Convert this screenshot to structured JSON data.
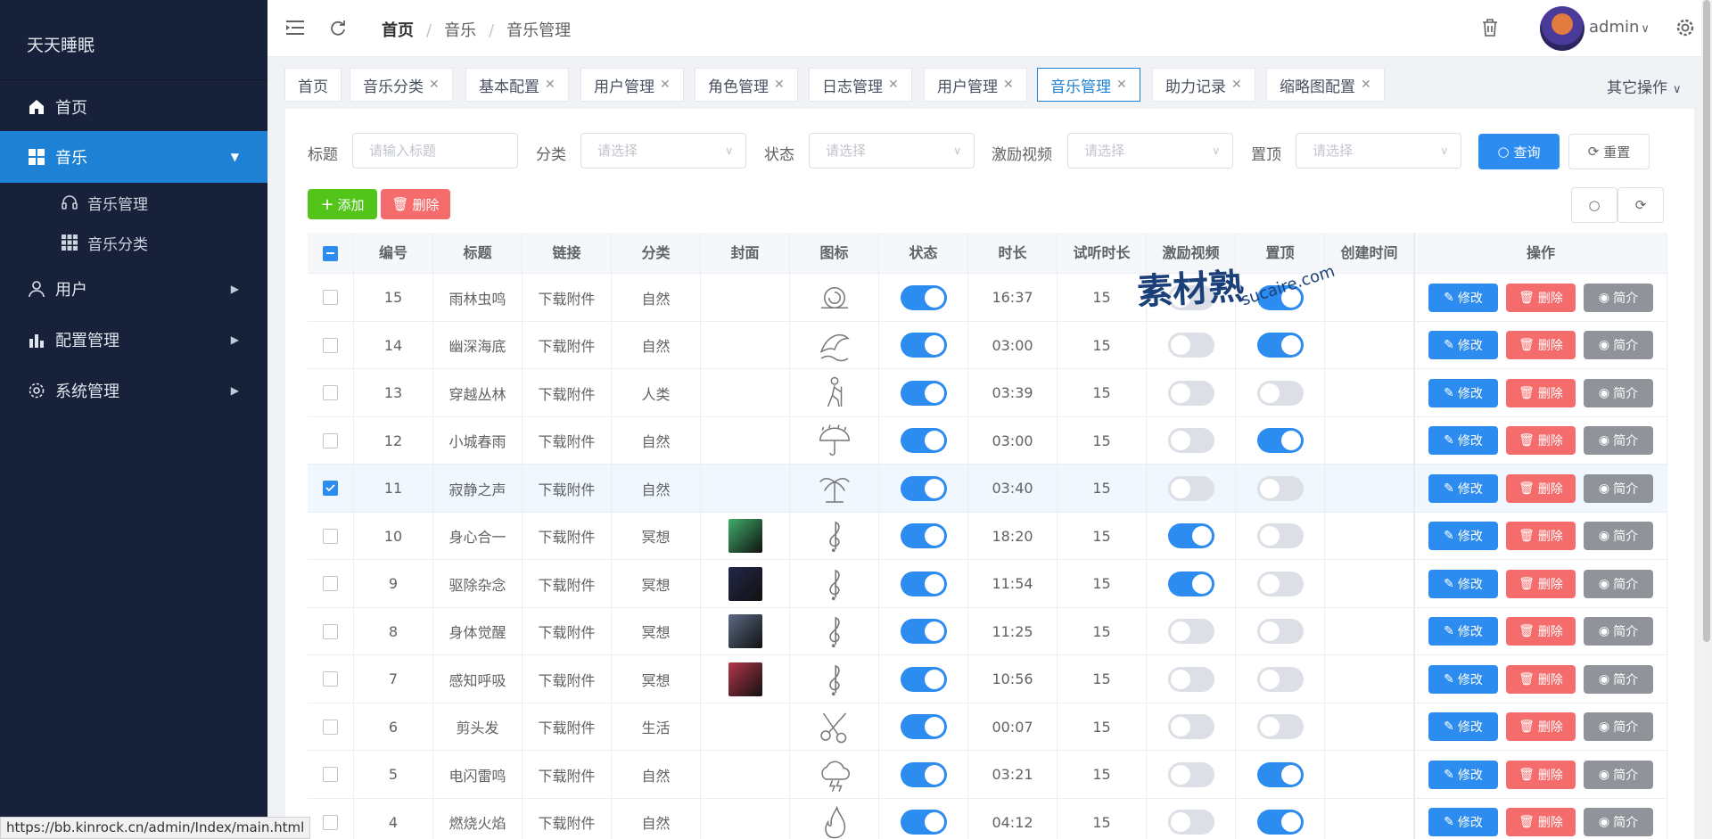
{
  "app": {
    "brand": "天天睡眠"
  },
  "sidebar": {
    "items": [
      {
        "label": "首页",
        "icon": "home-icon"
      },
      {
        "label": "音乐",
        "icon": "grid-icon"
      },
      {
        "label": "用户",
        "icon": "user-icon"
      },
      {
        "label": "配置管理",
        "icon": "bar-chart-icon"
      },
      {
        "label": "系统管理",
        "icon": "gear-icon"
      }
    ],
    "subitems": [
      {
        "label": "音乐管理",
        "icon": "headphones-icon"
      },
      {
        "label": "音乐分类",
        "icon": "grid-icon"
      }
    ]
  },
  "header": {
    "breadcrumb": [
      "首页",
      "音乐",
      "音乐管理"
    ],
    "username": "admin"
  },
  "tabs": [
    {
      "label": "首页",
      "closable": false
    },
    {
      "label": "音乐分类",
      "closable": true
    },
    {
      "label": "基本配置",
      "closable": true
    },
    {
      "label": "用户管理",
      "closable": true
    },
    {
      "label": "角色管理",
      "closable": true
    },
    {
      "label": "日志管理",
      "closable": true
    },
    {
      "label": "用户管理",
      "closable": true
    },
    {
      "label": "音乐管理",
      "closable": true,
      "active": true
    },
    {
      "label": "助力记录",
      "closable": true
    },
    {
      "label": "缩略图配置",
      "closable": true
    }
  ],
  "tabs_other": "其它操作",
  "filters": {
    "title_label": "标题",
    "title_placeholder": "请输入标题",
    "category_label": "分类",
    "status_label": "状态",
    "video_label": "激励视频",
    "top_label": "置顶",
    "select_placeholder": "请选择",
    "query_label": "查询",
    "reset_label": "重置"
  },
  "toolbar": {
    "add_label": "添加",
    "delete_label": "删除"
  },
  "table": {
    "columns": [
      "编号",
      "标题",
      "链接",
      "分类",
      "封面",
      "图标",
      "状态",
      "时长",
      "试听时长",
      "激励视频",
      "置顶",
      "创建时间",
      "操作"
    ],
    "action_labels": {
      "edit": "修改",
      "delete": "删除",
      "intro": "简介"
    },
    "rows": [
      {
        "id": "15",
        "title": "雨林虫鸣",
        "link": "下载附件",
        "category": "自然",
        "cover": null,
        "icon": "snail-icon",
        "status": true,
        "duration": "16:37",
        "trial": "15",
        "video": false,
        "top": true,
        "checked": false
      },
      {
        "id": "14",
        "title": "幽深海底",
        "link": "下载附件",
        "category": "自然",
        "cover": null,
        "icon": "dolphin-icon",
        "status": true,
        "duration": "03:00",
        "trial": "15",
        "video": false,
        "top": true,
        "checked": false
      },
      {
        "id": "13",
        "title": "穿越丛林",
        "link": "下载附件",
        "category": "人类",
        "cover": null,
        "icon": "hiker-icon",
        "status": true,
        "duration": "03:39",
        "trial": "15",
        "video": false,
        "top": false,
        "checked": false
      },
      {
        "id": "12",
        "title": "小城春雨",
        "link": "下载附件",
        "category": "自然",
        "cover": null,
        "icon": "umbrella-icon",
        "status": true,
        "duration": "03:00",
        "trial": "15",
        "video": false,
        "top": true,
        "checked": false
      },
      {
        "id": "11",
        "title": "寂静之声",
        "link": "下载附件",
        "category": "自然",
        "cover": null,
        "icon": "palm-tree-icon",
        "status": true,
        "duration": "03:40",
        "trial": "15",
        "video": false,
        "top": false,
        "checked": true
      },
      {
        "id": "10",
        "title": "身心合一",
        "link": "下载附件",
        "category": "冥想",
        "cover": "#3fae6a",
        "icon": "treble-clef-icon",
        "status": true,
        "duration": "18:20",
        "trial": "15",
        "video": true,
        "top": false,
        "checked": false
      },
      {
        "id": "9",
        "title": "驱除杂念",
        "link": "下载附件",
        "category": "冥想",
        "cover": "#23274a",
        "icon": "treble-clef-icon",
        "status": true,
        "duration": "11:54",
        "trial": "15",
        "video": true,
        "top": false,
        "checked": false
      },
      {
        "id": "8",
        "title": "身体觉醒",
        "link": "下载附件",
        "category": "冥想",
        "cover": "#5b6a85",
        "icon": "treble-clef-icon",
        "status": true,
        "duration": "11:25",
        "trial": "15",
        "video": false,
        "top": false,
        "checked": false
      },
      {
        "id": "7",
        "title": "感知呼吸",
        "link": "下载附件",
        "category": "冥想",
        "cover": "#b3364a",
        "icon": "treble-clef-icon",
        "status": true,
        "duration": "10:56",
        "trial": "15",
        "video": false,
        "top": false,
        "checked": false
      },
      {
        "id": "6",
        "title": "剪头发",
        "link": "下载附件",
        "category": "生活",
        "cover": null,
        "icon": "scissors-icon",
        "status": true,
        "duration": "00:07",
        "trial": "15",
        "video": false,
        "top": false,
        "checked": false
      },
      {
        "id": "5",
        "title": "电闪雷鸣",
        "link": "下载附件",
        "category": "自然",
        "cover": null,
        "icon": "thunder-cloud-icon",
        "status": true,
        "duration": "03:21",
        "trial": "15",
        "video": false,
        "top": true,
        "checked": false
      },
      {
        "id": "4",
        "title": "燃烧火焰",
        "link": "下载附件",
        "category": "自然",
        "cover": null,
        "icon": "flame-icon",
        "status": true,
        "duration": "04:12",
        "trial": "15",
        "video": false,
        "top": true,
        "checked": false
      }
    ]
  },
  "watermark": {
    "big": "素材熟",
    "small": "sucaire.com"
  },
  "status_url": "https://bb.kinrock.cn/admin/Index/main.html",
  "colors": {
    "primary": "#2d8cf0",
    "sidebar": "#17223a",
    "danger": "#f56c6c",
    "success": "#52c41a",
    "info": "#909399"
  }
}
